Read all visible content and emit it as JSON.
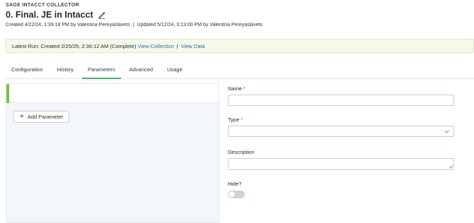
{
  "header": {
    "app_label": "SAGE INTACCT COLLECTOR",
    "title": "0. Final. JE in Intacct",
    "created": "Created 4/22/24, 1:39:18 PM by Valentina Pereyaslavets",
    "separator": "|",
    "updated": "Updated 5/12/24, 3:13:00 PM by Valentina Pereyaslavets"
  },
  "banner": {
    "text": "Latest Run: Created 2/25/25, 2:36:12 AM (Complete)",
    "view_collection": "View Collection",
    "separator": "|",
    "view_data": "View Data"
  },
  "tabs": [
    {
      "label": "Configuration"
    },
    {
      "label": "History"
    },
    {
      "label": "Parameters",
      "active": true
    },
    {
      "label": "Advanced"
    },
    {
      "label": "Usage"
    }
  ],
  "left_panel": {
    "add_parameter": "Add Parameter",
    "accent_color": "#7cc04a"
  },
  "form": {
    "name_label": "Name",
    "type_label": "Type",
    "description_label": "Description",
    "hide_label": "Hide?",
    "required_mark": "*",
    "name_value": "",
    "type_value": "",
    "description_value": "",
    "hide_on": false
  },
  "colors": {
    "link": "#1a6fb5",
    "active_tab_underline": "#5aa37a",
    "required": "#d23b3b"
  }
}
